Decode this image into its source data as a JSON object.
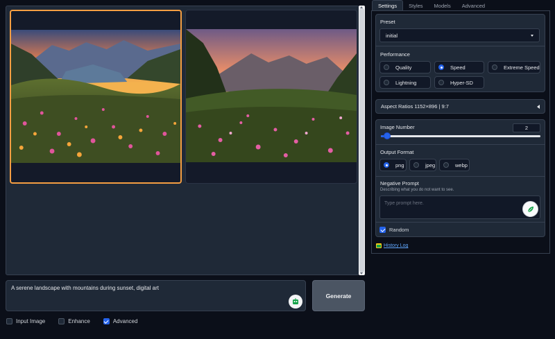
{
  "gallery": {
    "images": [
      {
        "selected": true,
        "alt": ""
      },
      {
        "selected": false,
        "alt": ""
      }
    ]
  },
  "prompt": {
    "text": "A serene landscape with mountains during sunset, digital art"
  },
  "generate": {
    "label": "Generate"
  },
  "bottom_options": [
    {
      "label": "Input Image",
      "checked": false
    },
    {
      "label": "Enhance",
      "checked": false
    },
    {
      "label": "Advanced",
      "checked": true
    }
  ],
  "tabs": [
    {
      "label": "Settings",
      "active": true
    },
    {
      "label": "Styles",
      "active": false
    },
    {
      "label": "Models",
      "active": false
    },
    {
      "label": "Advanced",
      "active": false
    }
  ],
  "preset": {
    "label": "Preset",
    "value": "initial"
  },
  "performance": {
    "label": "Performance",
    "options": [
      {
        "label": "Quality",
        "selected": false
      },
      {
        "label": "Speed",
        "selected": true
      },
      {
        "label": "Extreme Speed",
        "selected": false
      },
      {
        "label": "Lightning",
        "selected": false
      },
      {
        "label": "Hyper-SD",
        "selected": false
      }
    ]
  },
  "aspect_ratios": {
    "label": "Aspect Ratios 1152×896 | 9:7"
  },
  "image_number": {
    "label": "Image Number",
    "value": "2",
    "fraction": 0.03
  },
  "output_format": {
    "label": "Output Format",
    "options": [
      {
        "label": "png",
        "selected": true
      },
      {
        "label": "jpeg",
        "selected": false
      },
      {
        "label": "webp",
        "selected": false
      }
    ]
  },
  "negative_prompt": {
    "label": "Negative Prompt",
    "description": "Describing what you do not want to see.",
    "placeholder": "Type prompt here."
  },
  "random": {
    "label": "Random",
    "checked": true
  },
  "history": {
    "label": "History Log"
  },
  "colors": {
    "accent": "#2563eb",
    "selected_border": "#f59e42",
    "background": "#0b0f19",
    "card": "#1f2937"
  }
}
